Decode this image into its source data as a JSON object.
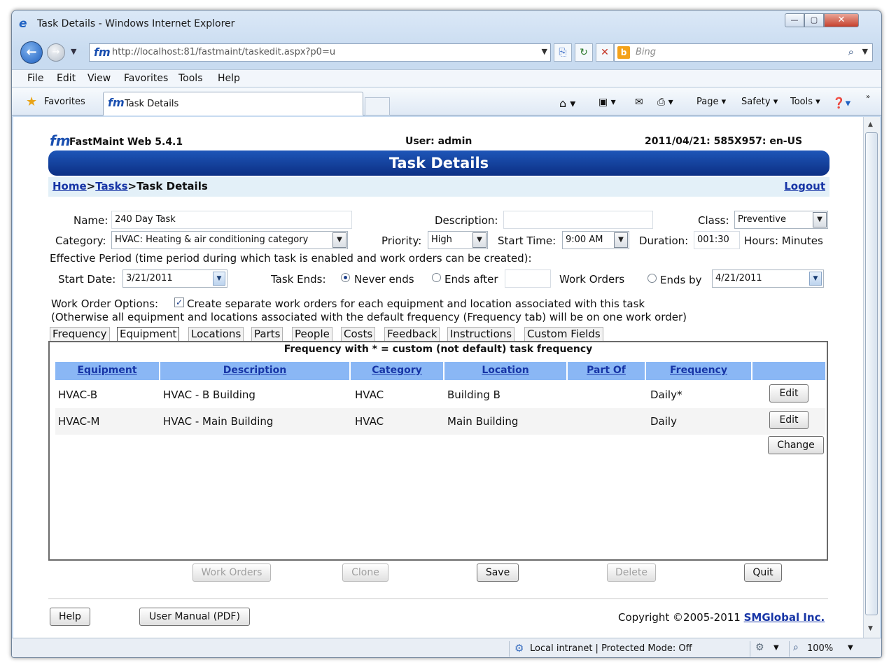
{
  "window": {
    "title": "Task Details - Windows Internet Explorer",
    "url": "http://localhost:81/fastmaint/taskedit.aspx?p0=u",
    "search_placeholder": "Bing",
    "menu": [
      "File",
      "Edit",
      "View",
      "Favorites",
      "Tools",
      "Help"
    ],
    "favorites_label": "Favorites",
    "tab_title": "Task Details",
    "commands": [
      "Page ▾",
      "Safety ▾",
      "Tools ▾"
    ]
  },
  "app": {
    "name": "FastMaint Web 5.4.1",
    "user": "User: admin",
    "date_info": "2011/04/21: 585X957: en-US",
    "page_title": "Task Details",
    "breadcrumb": {
      "home": "Home",
      "sep1": ">",
      "tasks": "Tasks",
      "current": ">Task Details"
    },
    "logout": "Logout"
  },
  "form": {
    "name_label": "Name:",
    "name_value": "240 Day Task",
    "description_label": "Description:",
    "description_value": "",
    "class_label": "Class:",
    "class_value": "Preventive",
    "category_label": "Category:",
    "category_value": "HVAC: Heating & air conditioning category",
    "priority_label": "Priority:",
    "priority_value": "High",
    "start_time_label": "Start Time:",
    "start_time_value": "9:00 AM",
    "duration_label": "Duration:",
    "duration_value": "001:30",
    "duration_unit": "Hours: Minutes",
    "effective_period": "Effective Period (time period during which task is enabled and work orders can be created):",
    "start_date_label": "Start Date:",
    "start_date_value": "3/21/2011",
    "task_ends_label": "Task Ends:",
    "never_ends": "Never ends",
    "ends_after": "Ends after",
    "ends_after_value": "",
    "work_orders": "Work Orders",
    "ends_by": "Ends by",
    "ends_by_value": "4/21/2011",
    "wo_options_label": "Work Order Options:",
    "wo_options_text": "Create separate work orders for each equipment and location associated with this task",
    "wo_options_note": "(Otherwise all equipment and locations associated with the default frequency (Frequency tab) will be on one work order)"
  },
  "tabs": [
    "Frequency",
    "Equipment",
    "Locations",
    "Parts",
    "People",
    "Costs",
    "Feedback",
    "Instructions",
    "Custom Fields"
  ],
  "panel": {
    "note": "Frequency with * = custom (not default) task frequency",
    "columns": [
      "Equipment",
      "Description",
      "Category",
      "Location",
      "Part Of",
      "Frequency"
    ],
    "rows": [
      {
        "equipment": "HVAC-B",
        "description": "HVAC - B Building",
        "category": "HVAC",
        "location": "Building B",
        "part_of": "",
        "frequency": "Daily*",
        "action": "Edit"
      },
      {
        "equipment": "HVAC-M",
        "description": "HVAC - Main Building",
        "category": "HVAC",
        "location": "Main Building",
        "part_of": "",
        "frequency": "Daily",
        "action": "Edit"
      }
    ],
    "change_button": "Change"
  },
  "actions": {
    "work_orders": "Work Orders",
    "clone": "Clone",
    "save": "Save",
    "delete": "Delete",
    "quit": "Quit"
  },
  "footer": {
    "help": "Help",
    "manual": "User Manual (PDF)",
    "copyright": "Copyright ©2005-2011 ",
    "company": "SMGlobal Inc."
  },
  "status": {
    "zone": "Local intranet | Protected Mode: Off",
    "zoom": "100%"
  }
}
